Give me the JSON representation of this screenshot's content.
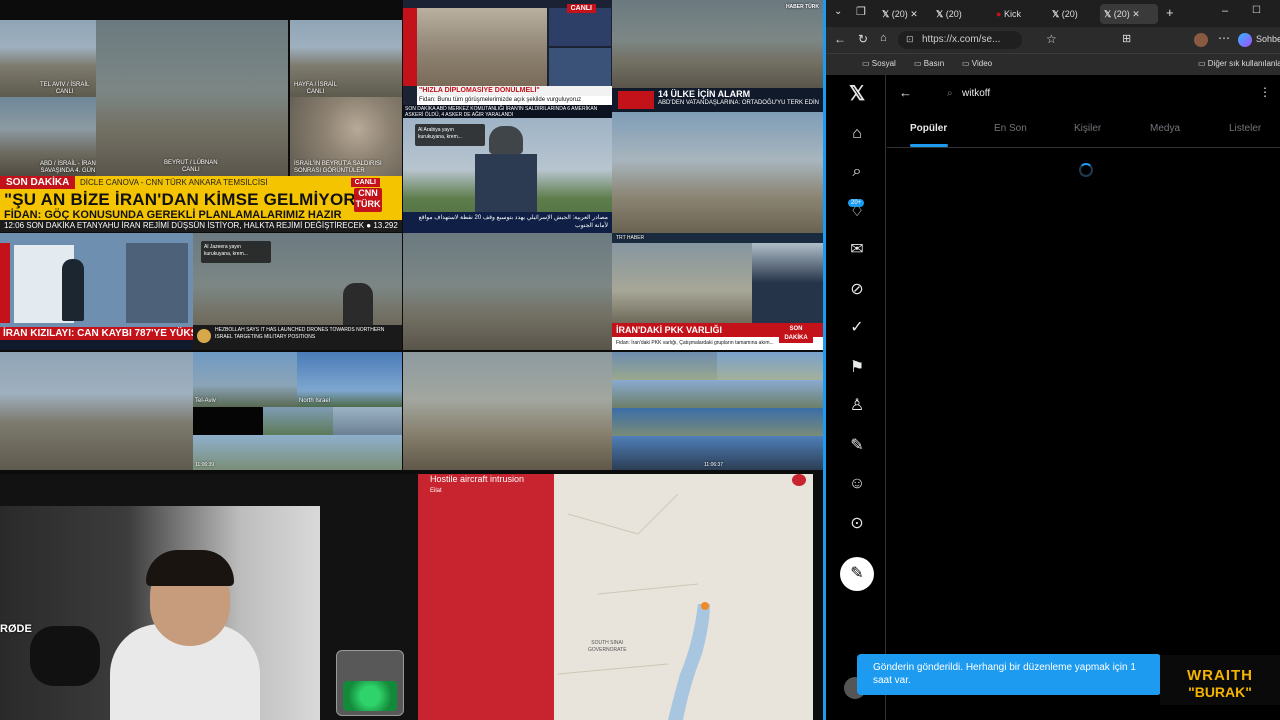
{
  "tiles": {
    "tl1_caption": "TEL AVIV / İSRAİL\nCANLI",
    "tl2_caption": "ABD / İSRAİL - İRAN\nSAVAŞINDA 4. GÜN",
    "tl3_caption": "BEYRUT / LÜBNAN\nCANLI",
    "tl4_caption": "HAYFA / İSRAİL\nCANLI",
    "tl5_caption": "İSRAİL'İN BEYRUT'A SALDIRISI\nSONRASI GÖRÜNTÜLER"
  },
  "cnn": {
    "son_dakika": "SON DAKİKA",
    "reporter": "DİCLE CANOVA - CNN TÜRK ANKARA TEMSİLCİSİ",
    "canli": "CANLI",
    "headline": "\"ŞU AN BİZE İRAN'DAN KİMSE GELMİYOR\"",
    "subline": "FİDAN: GÖÇ KONUSUNDA GEREKLİ PLANLAMALARIMIZ HAZIR",
    "ticker": "12:06   SON DAKİKA  ETANYAHU İRAN REJİMİ DÜŞSÜN İSTİYOR, HALKTA REJİMİ DEĞİŞTİRECEK  ● 13.292",
    "logo": "CNN\nTÜRK"
  },
  "news_center": {
    "son_dakika": "SON DAKİKA",
    "quote": "\"HIZLA DİPLOMASİYE DÖNÜLMELİ\"",
    "sub": "Fidan: Bunu tüm görüşmelerimizde açık şekilde vurguluyoruz",
    "ticker": "SON DAKİKA  ABD MERKEZ KOMUTANLIĞI İRAN'IN SALDIRILARINDA 6 AMERİKAN ASKERİ ÖLDÜ, 4 ASKER DE AĞIR YARALANDI",
    "canli": "CANLI",
    "aa_badge": "Al Arabiya yayın kurukuyana, krem...",
    "arabic_ticker": "مصادر العربية: الجيش الإسرائيلي يهدد بتوسيع وقف 20 نقطة لاستهداف مواقع لأمانة الجنوب"
  },
  "news_right": {
    "alarm": "14 ÜLKE İÇİN ALARM",
    "alarm_sub": "ABD'DEN VATANDAŞLARINA: ORTADOĞU'YU TERK EDİN",
    "haber": "HABER TÜRK",
    "pkk": "İRAN'DAKİ PKK VARLIĞI",
    "pkk_sub": "Fidan: İran'daki PKK varlığı, Çatışmalardaki grupların tamamına akım...",
    "son_dakika": "SON DAKİKA",
    "trt": "TRT HABER"
  },
  "red_cross": {
    "headline": "İRAN KIZILAYI: CAN KAYBI 787'YE YÜKSELDİ",
    "son_dakika": "SON DAKİKA"
  },
  "aljazeera": {
    "badge": "Al Jazeera yayın kurukuyana, krem...",
    "ticker": "HEZBOLLAH SAYS IT HAS LAUNCHED DRONES TOWARDS NORTHERN ISRAEL TARGETING MILITARY POSITIONS",
    "breaking": "BREAKING"
  },
  "cams": {
    "tel_aviv": "Tel-Aviv",
    "north_israel": "North Israel",
    "timestamp": "11:06:39",
    "timestamp2": "11:06:37"
  },
  "streamer": {
    "rode": "RØDE"
  },
  "map_panel": {
    "alert_title": "Hostile aircraft intrusion",
    "alert_city": "Eilat",
    "label": "SOUTH SINAI\nGOVERNORATE"
  },
  "browser": {
    "tabs": [
      "(20)",
      "(20)",
      "Kick",
      "(20)",
      "(20)"
    ],
    "url": "https://x.com/se...",
    "bookmarks": [
      "Sosyal",
      "Basın",
      "Video"
    ],
    "bookmarks_right": "Diğer sık kullanılanlar",
    "profile_label": "Sohbet"
  },
  "x": {
    "search_value": "witkoff",
    "tabs": [
      "Popüler",
      "En Son",
      "Kişiler",
      "Medya",
      "Listeler"
    ],
    "notif_badge": "20+",
    "toast": "Gönderin gönderildi. Herhangi bir düzenleme yapmak için 1 saat var."
  },
  "wraith": {
    "line1": "WRAITH",
    "line2": "\"BURAK\""
  },
  "colors": {
    "x_blue": "#1d9bf0",
    "news_red": "#c4121a",
    "cnn_yellow": "#f5c400",
    "alert_red": "#c7242f"
  }
}
